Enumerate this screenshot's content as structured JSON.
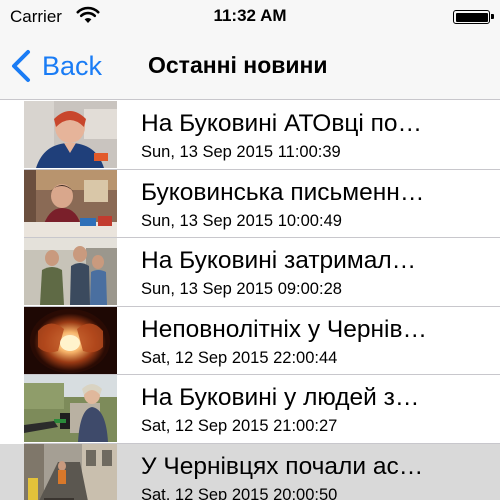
{
  "status_bar": {
    "carrier": "Carrier",
    "time": "11:32 AM",
    "wifi_icon": "wifi-icon",
    "battery_icon": "battery-icon",
    "battery_level": 1.0
  },
  "nav": {
    "back_label": "Back",
    "back_icon": "chevron-left-icon",
    "title": "Останні новини",
    "accent_color": "#1a7cf5"
  },
  "news": [
    {
      "title": "На Буковині АТОвці по…",
      "date": "Sun, 13 Sep 2015 11:00:39",
      "thumbnail": "woman-portrait-photo"
    },
    {
      "title": "Буковинська письменн…",
      "date": "Sun, 13 Sep 2015 10:00:49",
      "thumbnail": "writer-at-table-photo"
    },
    {
      "title": "На Буковині затримал…",
      "date": "Sun, 13 Sep 2015 09:00:28",
      "thumbnail": "men-in-corridor-photo"
    },
    {
      "title": "Неповнолітніх у Чернів…",
      "date": "Sat, 12 Sep 2015 22:00:44",
      "thumbnail": "glowing-hands-photo"
    },
    {
      "title": "На Буковині у людей з…",
      "date": "Sat, 12 Sep 2015 21:00:27",
      "thumbnail": "woman-interview-outdoors-photo"
    },
    {
      "title": "У Чернівцях почали ас…",
      "date": "Sat, 12 Sep 2015 20:00:50",
      "thumbnail": "road-works-photo",
      "selected": true
    }
  ]
}
